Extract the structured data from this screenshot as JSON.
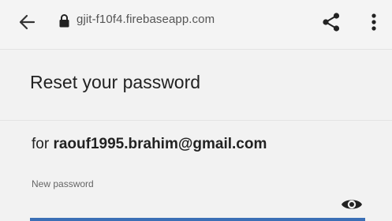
{
  "browser": {
    "url": "gjit-f10f4.firebaseapp.com",
    "icons": {
      "back": "arrow-left-icon",
      "lock": "lock-icon",
      "share": "share-icon",
      "more": "more-vertical-icon"
    }
  },
  "page": {
    "title": "Reset your password",
    "for_prefix": "for ",
    "email": "raouf1995.brahim@gmail.com",
    "new_password_label": "New password",
    "new_password_value": "",
    "icons": {
      "show_password": "eye-icon"
    },
    "accent_color": "#3b6fb6"
  }
}
